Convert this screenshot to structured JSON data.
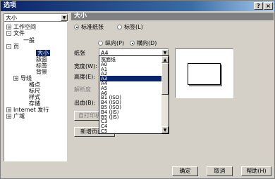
{
  "window": {
    "title": "选项",
    "help_btn": "?",
    "close_btn": "×"
  },
  "category_combo": {
    "value": "大小"
  },
  "tree": {
    "items": [
      {
        "label": "工作空间",
        "expander": "+"
      },
      {
        "label": "文件",
        "expander": "-"
      },
      {
        "label": "一般",
        "expander": ""
      },
      {
        "label": "页",
        "expander": "-"
      },
      {
        "label": "大小",
        "expander": ""
      },
      {
        "label": "版面",
        "expander": ""
      },
      {
        "label": "标签",
        "expander": ""
      },
      {
        "label": "背景",
        "expander": ""
      },
      {
        "label": "导线",
        "expander": "+"
      },
      {
        "label": "格点",
        "expander": ""
      },
      {
        "label": "标尺",
        "expander": ""
      },
      {
        "label": "样式",
        "expander": ""
      },
      {
        "label": "存储",
        "expander": ""
      },
      {
        "label": "Internet 发行",
        "expander": "+"
      },
      {
        "label": "广域",
        "expander": "+"
      }
    ]
  },
  "page": {
    "heading": "大小",
    "radio_normal_paper": "标准纸张",
    "radio_label": "标签(L)",
    "radio_portrait": "纵向(P)",
    "radio_landscape": "横向(D)",
    "paper_label": "纸张",
    "paper_value": "A4",
    "width_label": "宽度(W):",
    "height_label": "高度(E):",
    "resolution_label": "解析度",
    "bleed_label": "出血(B):",
    "set_from_printer_button": "自打印机设置",
    "add_page_frame_button": "新增页面框"
  },
  "paper_options": [
    "宽面纸",
    "A0",
    "A1",
    "A2",
    "A3",
    "A4",
    "A5",
    "A6",
    "B1 (ISO)",
    "B4 (ISO)",
    "B5 (ISO)",
    "B4 (JIS)",
    "B5 (JIS)",
    "C3",
    "C4",
    "C5"
  ],
  "paper_highlighted": "A3",
  "buttons": {
    "ok": "确定",
    "cancel": "取消",
    "help": "帮助(H)"
  }
}
